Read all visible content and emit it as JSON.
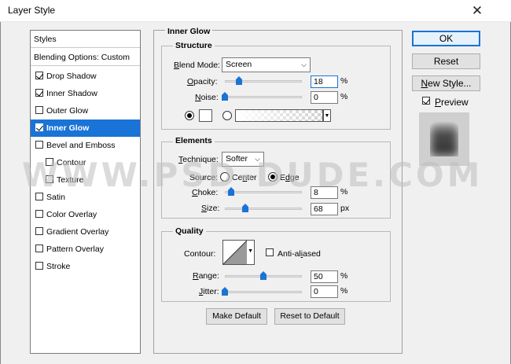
{
  "window": {
    "title": "Layer Style",
    "close_glyph": "✕"
  },
  "styles_list": {
    "header": "Styles",
    "blending_options": "Blending Options: Custom",
    "items": [
      {
        "label": "Drop Shadow",
        "checked": true
      },
      {
        "label": "Inner Shadow",
        "checked": true
      },
      {
        "label": "Outer Glow",
        "checked": false
      },
      {
        "label": "Inner Glow",
        "checked": true,
        "selected": true
      },
      {
        "label": "Bevel and Emboss",
        "checked": false
      },
      {
        "label": "Contour",
        "checked": false,
        "sub": true
      },
      {
        "label": "Texture",
        "checked": false,
        "sub": true
      },
      {
        "label": "Satin",
        "checked": false
      },
      {
        "label": "Color Overlay",
        "checked": false
      },
      {
        "label": "Gradient Overlay",
        "checked": false
      },
      {
        "label": "Pattern Overlay",
        "checked": false
      },
      {
        "label": "Stroke",
        "checked": false
      }
    ]
  },
  "inner_glow": {
    "group_title": "Inner Glow",
    "structure": {
      "title": "Structure",
      "blend_mode_label": "Blend Mode:",
      "blend_mode_value": "Screen",
      "opacity_label": "Opacity:",
      "opacity_value": "18",
      "opacity_fraction": 0.18,
      "noise_label": "Noise:",
      "noise_value": "0",
      "noise_fraction": 0,
      "percent": "%"
    },
    "elements": {
      "title": "Elements",
      "technique_label": "Technique:",
      "technique_value": "Softer",
      "source_label": "Source:",
      "source_center": "Center",
      "source_edge": "Edge",
      "choke_label": "Choke:",
      "choke_value": "8",
      "choke_fraction": 0.08,
      "size_label": "Size:",
      "size_value": "68",
      "size_fraction": 0.27,
      "percent": "%",
      "px": "px"
    },
    "quality": {
      "title": "Quality",
      "contour_label": "Contour:",
      "anti_aliased_label": "Anti-aliased",
      "range_label": "Range:",
      "range_value": "50",
      "range_fraction": 0.5,
      "jitter_label": "Jitter:",
      "jitter_value": "0",
      "jitter_fraction": 0,
      "percent": "%"
    },
    "make_default": "Make Default",
    "reset_to_default": "Reset to Default"
  },
  "buttons": {
    "ok": "OK",
    "reset": "Reset",
    "new_style": "New Style...",
    "preview_label": "Preview"
  },
  "watermark": "WWW.PSD-DUDE.COM",
  "colors": {
    "accent": "#1a73d6",
    "selection_bg": "#1a73d6",
    "dialog_bg": "#f0f0f0"
  }
}
